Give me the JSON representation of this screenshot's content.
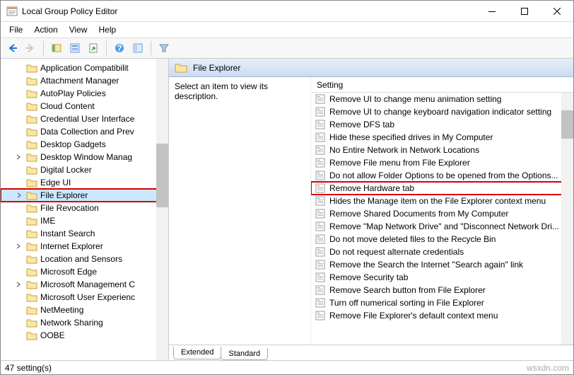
{
  "window": {
    "title": "Local Group Policy Editor"
  },
  "menu": {
    "file": "File",
    "action": "Action",
    "view": "View",
    "help": "Help"
  },
  "tree": {
    "items": [
      {
        "label": "Application Compatibilit",
        "expandable": false
      },
      {
        "label": "Attachment Manager",
        "expandable": false
      },
      {
        "label": "AutoPlay Policies",
        "expandable": false
      },
      {
        "label": "Cloud Content",
        "expandable": false
      },
      {
        "label": "Credential User Interface",
        "expandable": false
      },
      {
        "label": "Data Collection and Prev",
        "expandable": false
      },
      {
        "label": "Desktop Gadgets",
        "expandable": false
      },
      {
        "label": "Desktop Window Manag",
        "expandable": true
      },
      {
        "label": "Digital Locker",
        "expandable": false
      },
      {
        "label": "Edge UI",
        "expandable": false
      },
      {
        "label": "File Explorer",
        "expandable": true,
        "selected": true,
        "highlight": true
      },
      {
        "label": "File Revocation",
        "expandable": false
      },
      {
        "label": "IME",
        "expandable": false
      },
      {
        "label": "Instant Search",
        "expandable": false
      },
      {
        "label": "Internet Explorer",
        "expandable": true
      },
      {
        "label": "Location and Sensors",
        "expandable": false
      },
      {
        "label": "Microsoft Edge",
        "expandable": false
      },
      {
        "label": "Microsoft Management C",
        "expandable": true
      },
      {
        "label": "Microsoft User Experienc",
        "expandable": false
      },
      {
        "label": "NetMeeting",
        "expandable": false
      },
      {
        "label": "Network Sharing",
        "expandable": false
      },
      {
        "label": "OOBE",
        "expandable": false
      }
    ]
  },
  "header": {
    "title": "File Explorer"
  },
  "description": {
    "text": "Select an item to view its description."
  },
  "listheader": {
    "col": "Setting"
  },
  "settings": [
    {
      "label": "Remove UI to change menu animation setting"
    },
    {
      "label": "Remove UI to change keyboard navigation indicator setting"
    },
    {
      "label": "Remove DFS tab"
    },
    {
      "label": "Hide these specified drives in My Computer"
    },
    {
      "label": "No Entire Network in Network Locations"
    },
    {
      "label": "Remove File menu from File Explorer"
    },
    {
      "label": "Do not allow Folder Options to be opened from the Options..."
    },
    {
      "label": "Remove Hardware tab",
      "highlight": true
    },
    {
      "label": "Hides the Manage item on the File Explorer context menu"
    },
    {
      "label": "Remove Shared Documents from My Computer"
    },
    {
      "label": "Remove \"Map Network Drive\" and \"Disconnect Network Dri..."
    },
    {
      "label": "Do not move deleted files to the Recycle Bin"
    },
    {
      "label": "Do not request alternate credentials"
    },
    {
      "label": "Remove the Search the Internet \"Search again\" link"
    },
    {
      "label": "Remove Security tab"
    },
    {
      "label": "Remove Search button from File Explorer"
    },
    {
      "label": "Turn off numerical sorting in File Explorer"
    },
    {
      "label": "Remove File Explorer's default context menu"
    }
  ],
  "tabs": {
    "extended": "Extended",
    "standard": "Standard"
  },
  "status": {
    "count": "47 setting(s)",
    "watermark": "wsxdn.com"
  }
}
